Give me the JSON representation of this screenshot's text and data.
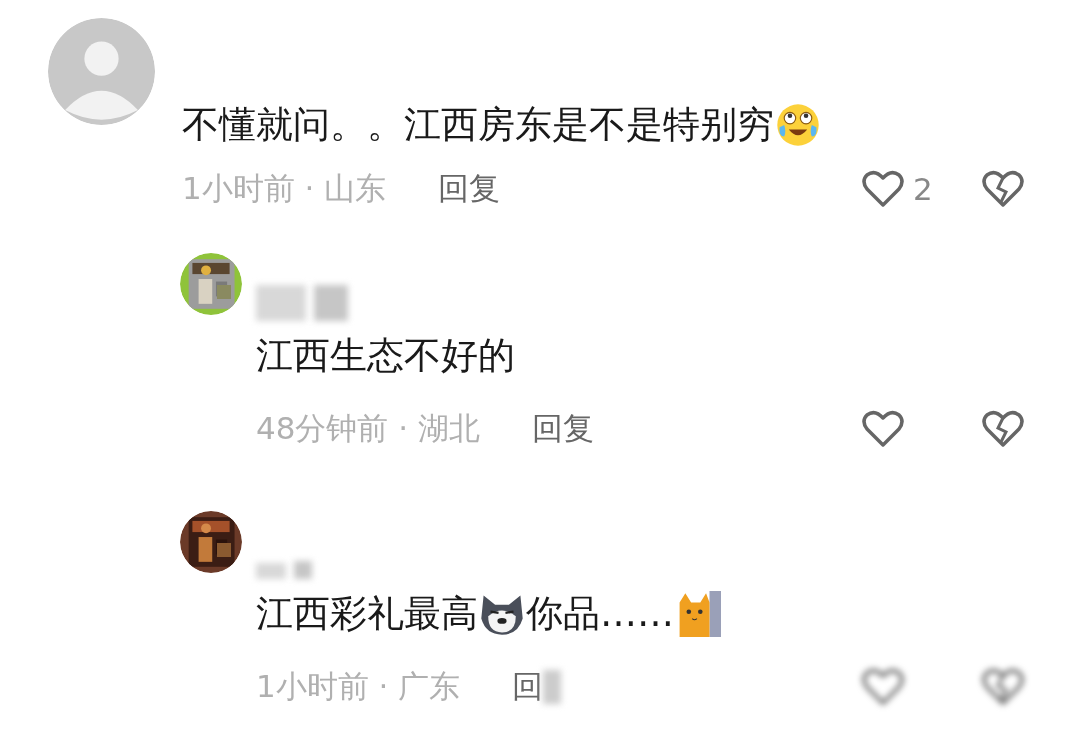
{
  "comments": [
    {
      "avatar": {
        "kind": "default"
      },
      "segments": [
        {
          "kind": "text",
          "text": "不懂就问。。江西房东是不是特别穷"
        },
        {
          "kind": "laugh"
        }
      ],
      "time": "1小时前 · 山东",
      "reply": "回复",
      "likes": "2",
      "blurred": false,
      "children": [
        {
          "avatar": {
            "kind": "picture"
          },
          "segments": [
            {
              "kind": "text",
              "text": "江西生态不好的"
            }
          ],
          "time": "48分钟前 · 湖北",
          "reply": "回复",
          "blurred": false
        },
        {
          "avatar": {
            "kind": "picture"
          },
          "segments": [
            {
              "kind": "text",
              "text": "江西彩礼最高"
            },
            {
              "kind": "dog"
            },
            {
              "kind": "text",
              "text": "你品……"
            },
            {
              "kind": "cat"
            }
          ],
          "time": "1小时前 · 广东",
          "reply": "回",
          "blurred": true
        }
      ]
    }
  ]
}
